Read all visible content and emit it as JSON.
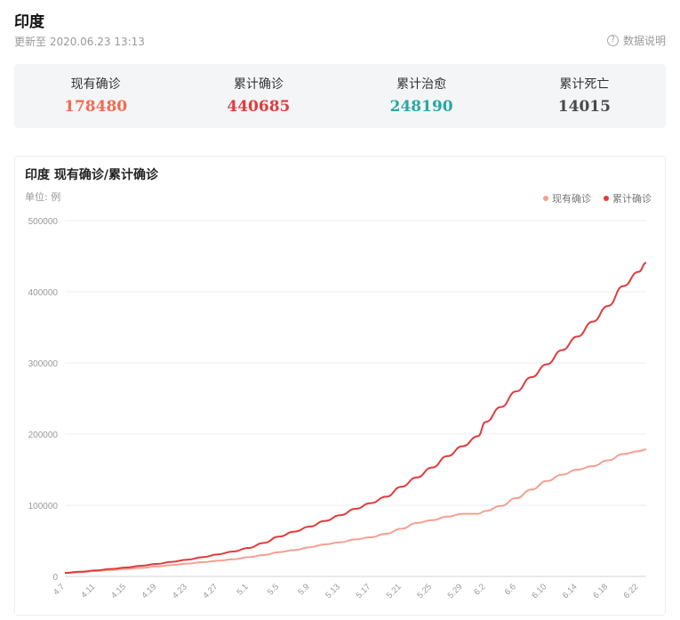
{
  "header": {
    "country": "印度",
    "update_time": "更新至 2020.06.23 13:13",
    "data_note": "数据说明",
    "help_glyph": "?"
  },
  "stats": [
    {
      "label": "现有确诊",
      "value": "178480",
      "color": "#f4694f"
    },
    {
      "label": "累计确诊",
      "value": "440685",
      "color": "#e03c3c"
    },
    {
      "label": "累计治愈",
      "value": "248190",
      "color": "#27a9a3"
    },
    {
      "label": "累计死亡",
      "value": "14015",
      "color": "#4a4a4a"
    }
  ],
  "chart_data": {
    "type": "line",
    "title": "印度 现有确诊/累计确诊",
    "unit": "单位: 例",
    "ylim": [
      0,
      500000
    ],
    "yticks": [
      "0",
      "100000",
      "200000",
      "300000",
      "400000",
      "500000"
    ],
    "x_ticks": [
      "4.7",
      "4.11",
      "4.15",
      "4.19",
      "4.23",
      "4.27",
      "5.1",
      "5.5",
      "5.9",
      "5.13",
      "5.17",
      "5.21",
      "5.25",
      "5.29",
      "6.2",
      "6.6",
      "6.10",
      "6.14",
      "6.18",
      "6.22"
    ],
    "x": [
      "4.7",
      "4.9",
      "4.11",
      "4.13",
      "4.15",
      "4.17",
      "4.19",
      "4.21",
      "4.23",
      "4.25",
      "4.27",
      "4.29",
      "5.1",
      "5.3",
      "5.5",
      "5.7",
      "5.9",
      "5.11",
      "5.13",
      "5.15",
      "5.17",
      "5.19",
      "5.21",
      "5.23",
      "5.25",
      "5.27",
      "5.29",
      "5.31",
      "6.2",
      "6.4",
      "6.6",
      "6.8",
      "6.10",
      "6.12",
      "6.14",
      "6.16",
      "6.18",
      "6.20",
      "6.22",
      "6.23"
    ],
    "grid": true,
    "legend_position": "top-right",
    "series": [
      {
        "name": "现有确诊",
        "color": "#f4a091",
        "values": [
          4700,
          6000,
          7500,
          9000,
          10500,
          12000,
          14000,
          16000,
          18000,
          20000,
          22000,
          24000,
          27000,
          30000,
          34000,
          37000,
          41000,
          45000,
          48000,
          52000,
          55000,
          60000,
          67000,
          75000,
          79000,
          84000,
          88000,
          88000,
          92000,
          99000,
          110000,
          122000,
          134000,
          143000,
          150000,
          155000,
          163000,
          172000,
          176000,
          178480
        ]
      },
      {
        "name": "累计确诊",
        "color": "#e03c3c",
        "values": [
          5000,
          6500,
          8400,
          10500,
          12500,
          15000,
          17500,
          20500,
          23500,
          27000,
          31000,
          35000,
          40000,
          47000,
          56000,
          63000,
          70000,
          78000,
          86000,
          95000,
          103000,
          112000,
          126000,
          139000,
          153000,
          169000,
          183000,
          197000,
          217000,
          238000,
          260000,
          280000,
          298000,
          318000,
          337000,
          358000,
          380000,
          408000,
          428000,
          440685
        ]
      }
    ]
  }
}
